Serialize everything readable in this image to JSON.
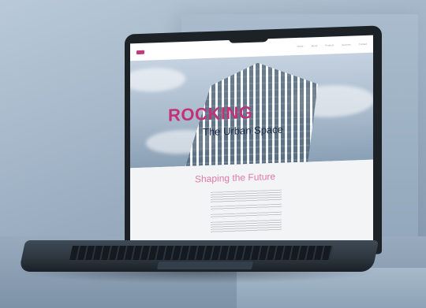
{
  "site": {
    "nav_items": [
      "Home",
      "About",
      "Projects",
      "Services",
      "Contact"
    ],
    "hero": {
      "title": "ROCKING",
      "subtitle": "The Urban Space"
    },
    "section": {
      "title": "Shaping the Future"
    }
  },
  "colors": {
    "accent": "#c2317a",
    "subtitle": "#1f2a44",
    "section_title": "#e07aa8"
  }
}
